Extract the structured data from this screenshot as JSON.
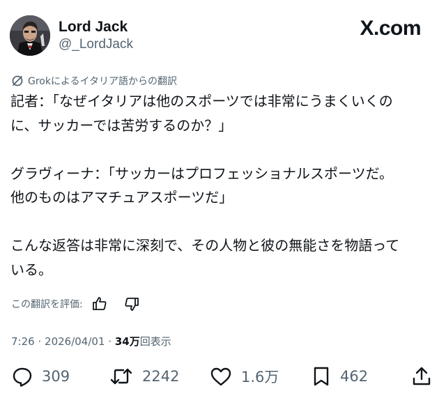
{
  "author": {
    "name": "Lord Jack",
    "handle": "@_LordJack"
  },
  "brand": "X.com",
  "translation_note": "Grokによるイタリア語からの翻訳",
  "post": {
    "lines": [
      "記者：「なぜイタリアは他のスポーツでは非常にうまくいくの",
      "に、サッカーでは苦労するのか？」",
      "",
      "グラヴィーナ：「サッカーはプロフェッショナルスポーツだ。",
      "他のものはアマチュアスポーツだ」",
      "",
      "こんな返答は非常に深刻で、その人物と彼の無能さを物語って",
      "いる。"
    ]
  },
  "rating": {
    "label": "この翻訳を評価:",
    "icons": [
      "thumbs-up-icon",
      "thumbs-down-icon"
    ]
  },
  "meta": {
    "time": "7:26",
    "separator": "·",
    "date": "2026/04/01",
    "views_count": "34万",
    "views_label": "回表示"
  },
  "actions": {
    "replies": "309",
    "reposts": "2242",
    "likes": "1.6万",
    "bookmarks": "462"
  },
  "colors": {
    "text": "#0f1419",
    "secondary": "#536471",
    "background": "#ffffff"
  }
}
